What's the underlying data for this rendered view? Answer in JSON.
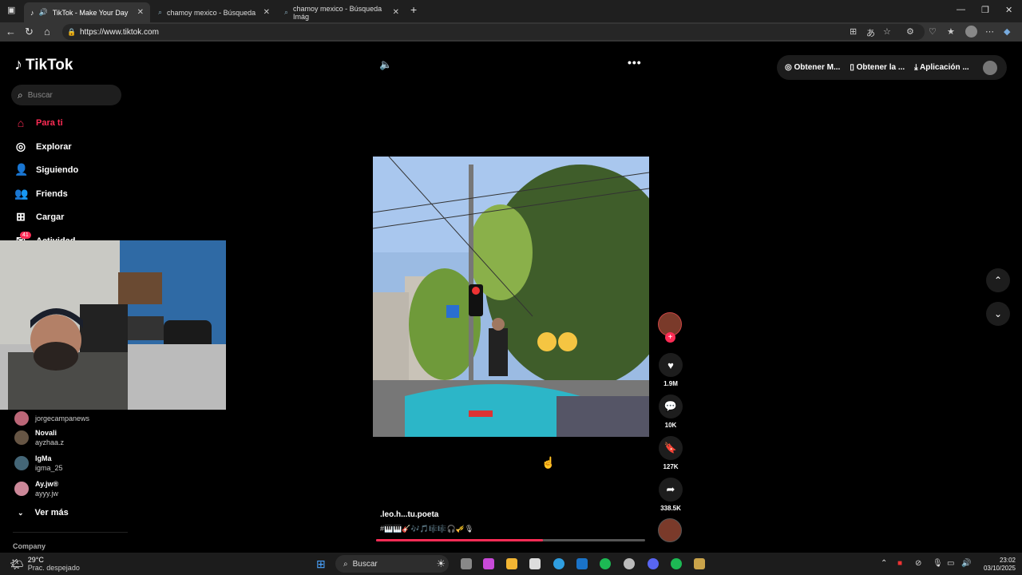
{
  "browser": {
    "tabs": [
      {
        "label": "TikTok - Make Your Day"
      },
      {
        "label": "chamoy mexico - Búsqueda"
      },
      {
        "label": "chamoy mexico - Búsqueda Imág"
      }
    ],
    "url": "https://www.tiktok.com"
  },
  "sidebar": {
    "logo": "TikTok",
    "search_placeholder": "Buscar",
    "nav": [
      {
        "label": "Para ti",
        "icon": "home-icon"
      },
      {
        "label": "Explorar",
        "icon": "compass-icon"
      },
      {
        "label": "Siguiendo",
        "icon": "following-icon"
      },
      {
        "label": "Friends",
        "icon": "friends-icon"
      },
      {
        "label": "Cargar",
        "icon": "upload-icon"
      },
      {
        "label": "Actividad",
        "icon": "activity-icon",
        "badge": "41"
      }
    ],
    "following": [
      {
        "name": "",
        "user": "jorgecampanews"
      },
      {
        "name": "Novali",
        "user": "ayzhaa.z"
      },
      {
        "name": "IgMa",
        "user": "igma_25"
      },
      {
        "name": "Ay.jw®",
        "user": "ayyy.jw"
      }
    ],
    "see_more": "Ver más",
    "footer": "Company"
  },
  "topbar": {
    "items": [
      "Obtener M...",
      "Obtener la ...",
      "Aplicación ..."
    ]
  },
  "video": {
    "likes": "1.9M",
    "comments": "10K",
    "saves": "127K",
    "shares": "338.5K",
    "caption": ".leo.h...tu.poeta",
    "tags": "#🎹🎹🎸🎶🎵🎼🎼🎧🎺🎙",
    "progress": 0.62
  },
  "taskbar": {
    "temp": "29°C",
    "weather": "Prac. despejado",
    "search": "Buscar",
    "time": "23:02",
    "date": "03/10/2025"
  },
  "colors": {
    "accent": "#fe2c55"
  }
}
